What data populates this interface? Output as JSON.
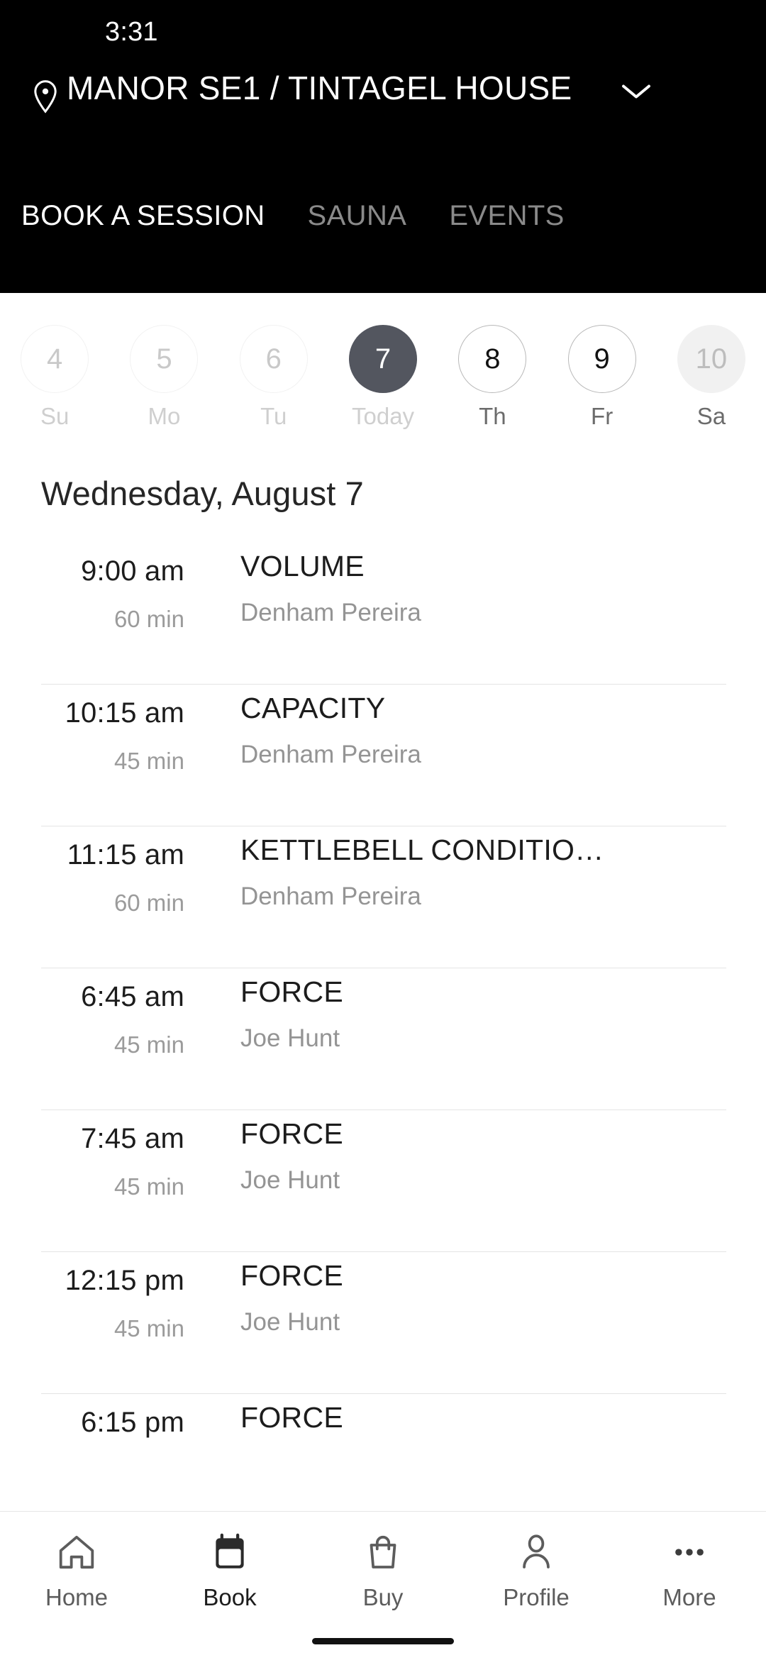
{
  "statusbar": {
    "time": "3:31"
  },
  "header": {
    "location_icon": "location-pin-icon",
    "venue": "MANOR SE1 / TINTAGEL HOUSE",
    "chevron_icon": "chevron-down-icon",
    "tabs": [
      {
        "label": "BOOK A SESSION",
        "active": true
      },
      {
        "label": "SAUNA",
        "active": false
      },
      {
        "label": "EVENTS",
        "active": false
      }
    ]
  },
  "datestrip": [
    {
      "num": "4",
      "day": "Su",
      "state": "past"
    },
    {
      "num": "5",
      "day": "Mo",
      "state": "past"
    },
    {
      "num": "6",
      "day": "Tu",
      "state": "past"
    },
    {
      "num": "7",
      "day": "Today",
      "state": "today"
    },
    {
      "num": "8",
      "day": "Th",
      "state": "future"
    },
    {
      "num": "9",
      "day": "Fr",
      "state": "future"
    },
    {
      "num": "10",
      "day": "Sa",
      "state": "disabled"
    }
  ],
  "schedule": {
    "heading": "Wednesday, August 7",
    "rows": [
      {
        "time": "9:00 am",
        "duration": "60 min",
        "name": "VOLUME",
        "instructor": "Denham Pereira"
      },
      {
        "time": "10:15 am",
        "duration": "45 min",
        "name": "CAPACITY",
        "instructor": "Denham Pereira"
      },
      {
        "time": "11:15 am",
        "duration": "60 min",
        "name": "KETTLEBELL CONDITIO…",
        "instructor": "Denham Pereira"
      },
      {
        "time": "6:45 am",
        "duration": "45 min",
        "name": "FORCE",
        "instructor": "Joe Hunt"
      },
      {
        "time": "7:45 am",
        "duration": "45 min",
        "name": "FORCE",
        "instructor": "Joe Hunt"
      },
      {
        "time": "12:15 pm",
        "duration": "45 min",
        "name": "FORCE",
        "instructor": "Joe Hunt"
      },
      {
        "time": "6:15 pm",
        "duration": "",
        "name": "FORCE",
        "instructor": ""
      }
    ]
  },
  "bottomnav": [
    {
      "label": "Home",
      "icon": "home-icon",
      "active": false
    },
    {
      "label": "Book",
      "icon": "calendar-icon",
      "active": true
    },
    {
      "label": "Buy",
      "icon": "bag-icon",
      "active": false
    },
    {
      "label": "Profile",
      "icon": "person-icon",
      "active": false
    },
    {
      "label": "More",
      "icon": "ellipsis-icon",
      "active": false
    }
  ],
  "colors": {
    "header_bg": "#000000",
    "today_circle": "#53565f",
    "disabled_circle": "#f1f1f1",
    "divider": "#e4e4e4",
    "muted_text": "#949494",
    "primary_text": "#1c1c1c"
  }
}
